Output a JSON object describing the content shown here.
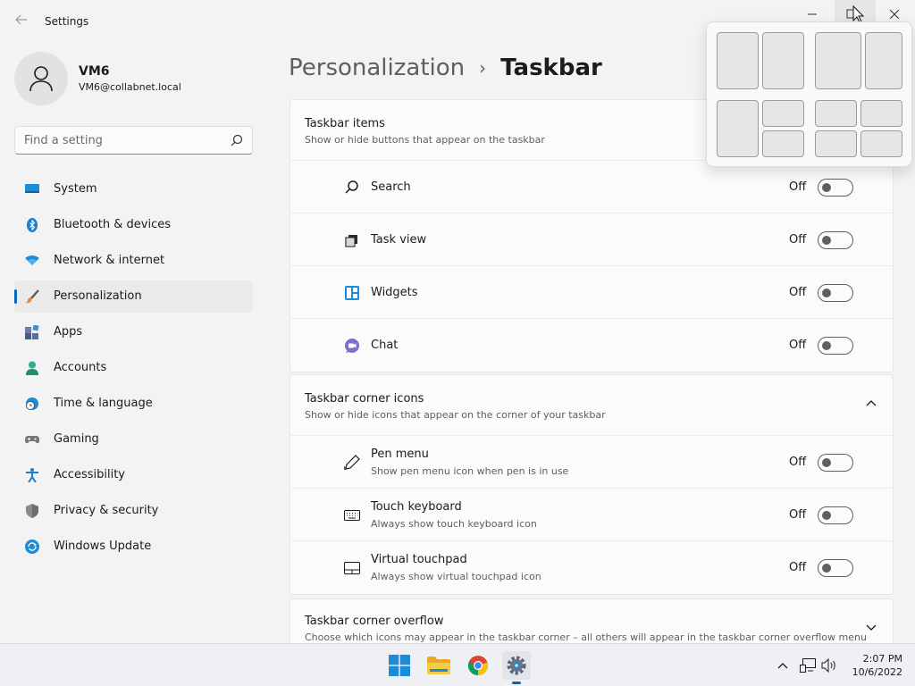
{
  "window": {
    "title": "Settings",
    "minimize_glyph": "—",
    "close_glyph": "✕"
  },
  "user": {
    "name": "VM6",
    "email": "VM6@collabnet.local"
  },
  "search": {
    "placeholder": "Find a setting"
  },
  "sidebar": {
    "items": [
      {
        "label": "System",
        "icon": "monitor-icon"
      },
      {
        "label": "Bluetooth & devices",
        "icon": "bluetooth-icon"
      },
      {
        "label": "Network & internet",
        "icon": "wifi-icon"
      },
      {
        "label": "Personalization",
        "icon": "brush-icon",
        "active": true
      },
      {
        "label": "Apps",
        "icon": "apps-icon"
      },
      {
        "label": "Accounts",
        "icon": "person-icon"
      },
      {
        "label": "Time & language",
        "icon": "globe-clock-icon"
      },
      {
        "label": "Gaming",
        "icon": "gamepad-icon"
      },
      {
        "label": "Accessibility",
        "icon": "accessibility-icon"
      },
      {
        "label": "Privacy & security",
        "icon": "shield-icon"
      },
      {
        "label": "Windows Update",
        "icon": "update-icon"
      }
    ]
  },
  "breadcrumb": {
    "parent": "Personalization",
    "separator": "›",
    "current": "Taskbar"
  },
  "taskbar_items": {
    "title": "Taskbar items",
    "subtitle": "Show or hide buttons that appear on the taskbar",
    "rows": [
      {
        "label": "Search",
        "state": "Off"
      },
      {
        "label": "Task view",
        "state": "Off"
      },
      {
        "label": "Widgets",
        "state": "Off"
      },
      {
        "label": "Chat",
        "state": "Off"
      }
    ]
  },
  "corner_icons": {
    "title": "Taskbar corner icons",
    "subtitle": "Show or hide icons that appear on the corner of your taskbar",
    "rows": [
      {
        "label": "Pen menu",
        "desc": "Show pen menu icon when pen is in use",
        "state": "Off"
      },
      {
        "label": "Touch keyboard",
        "desc": "Always show touch keyboard icon",
        "state": "Off"
      },
      {
        "label": "Virtual touchpad",
        "desc": "Always show virtual touchpad icon",
        "state": "Off"
      }
    ]
  },
  "corner_overflow": {
    "title": "Taskbar corner overflow",
    "subtitle": "Choose which icons may appear in the taskbar corner – all others will appear in the taskbar corner overflow menu"
  },
  "colors": {
    "accent": "#0067c0",
    "background": "#f3f3f3",
    "card": "#fbfbfb"
  },
  "system_tray": {
    "time": "2:07 PM",
    "date": "10/6/2022"
  }
}
